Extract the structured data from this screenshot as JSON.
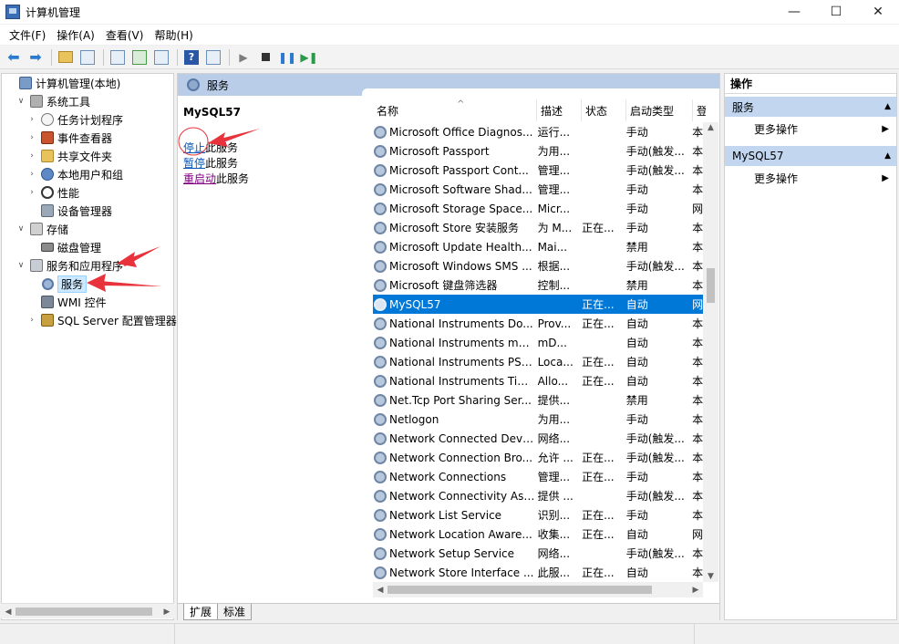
{
  "window": {
    "title": "计算机管理"
  },
  "menu": [
    "文件(F)",
    "操作(A)",
    "查看(V)",
    "帮助(H)"
  ],
  "tree": [
    {
      "label": "计算机管理(本地)",
      "arrow": "",
      "level": 0,
      "icon": "computer-icon"
    },
    {
      "label": "系统工具",
      "arrow": "∨",
      "level": 1,
      "icon": "tools-icon"
    },
    {
      "label": "任务计划程序",
      "arrow": "›",
      "level": 2,
      "icon": "clock-icon"
    },
    {
      "label": "事件查看器",
      "arrow": "›",
      "level": 2,
      "icon": "event-viewer-icon"
    },
    {
      "label": "共享文件夹",
      "arrow": "›",
      "level": 2,
      "icon": "shared-folder-icon"
    },
    {
      "label": "本地用户和组",
      "arrow": "›",
      "level": 2,
      "icon": "users-icon"
    },
    {
      "label": "性能",
      "arrow": "›",
      "level": 2,
      "icon": "performance-icon"
    },
    {
      "label": "设备管理器",
      "arrow": "",
      "level": 2,
      "icon": "device-manager-icon"
    },
    {
      "label": "存储",
      "arrow": "∨",
      "level": 1,
      "icon": "storage-icon"
    },
    {
      "label": "磁盘管理",
      "arrow": "",
      "level": 2,
      "icon": "disk-icon"
    },
    {
      "label": "服务和应用程序",
      "arrow": "∨",
      "level": 1,
      "icon": "apps-icon"
    },
    {
      "label": "服务",
      "arrow": "",
      "level": 2,
      "icon": "services-gear-icon",
      "selected": true
    },
    {
      "label": "WMI 控件",
      "arrow": "",
      "level": 2,
      "icon": "wmi-icon"
    },
    {
      "label": "SQL Server 配置管理器",
      "arrow": "›",
      "level": 2,
      "icon": "sql-server-icon"
    }
  ],
  "center": {
    "header": "服务",
    "detail": {
      "name": "MySQL57",
      "stop_link": "停止",
      "stop_rest": "此服务",
      "pause_link": "暂停",
      "pause_rest": "此服务",
      "restart_link": "重启动",
      "restart_rest": "此服务"
    },
    "columns": [
      "名称",
      "描述",
      "状态",
      "启动类型",
      "登"
    ],
    "rows": [
      {
        "name": "Microsoft Office Diagnos...",
        "desc": "运行...",
        "status": "",
        "startup": "手动",
        "logon": "本"
      },
      {
        "name": "Microsoft Passport",
        "desc": "为用...",
        "status": "",
        "startup": "手动(触发...",
        "logon": "本"
      },
      {
        "name": "Microsoft Passport Cont...",
        "desc": "管理...",
        "status": "",
        "startup": "手动(触发...",
        "logon": "本"
      },
      {
        "name": "Microsoft Software Shad...",
        "desc": "管理...",
        "status": "",
        "startup": "手动",
        "logon": "本"
      },
      {
        "name": "Microsoft Storage Space...",
        "desc": "Micr...",
        "status": "",
        "startup": "手动",
        "logon": "网"
      },
      {
        "name": "Microsoft Store 安装服务",
        "desc": "为 M...",
        "status": "正在...",
        "startup": "手动",
        "logon": "本"
      },
      {
        "name": "Microsoft Update Health...",
        "desc": "Mai...",
        "status": "",
        "startup": "禁用",
        "logon": "本"
      },
      {
        "name": "Microsoft Windows SMS ...",
        "desc": "根据...",
        "status": "",
        "startup": "手动(触发...",
        "logon": "本"
      },
      {
        "name": "Microsoft 键盘筛选器",
        "desc": "控制...",
        "status": "",
        "startup": "禁用",
        "logon": "本"
      },
      {
        "name": "MySQL57",
        "desc": "",
        "status": "正在...",
        "startup": "自动",
        "logon": "网",
        "selected": true
      },
      {
        "name": "National Instruments Do...",
        "desc": "Prov...",
        "status": "正在...",
        "startup": "自动",
        "logon": "本"
      },
      {
        "name": "National Instruments mD...",
        "desc": "mD...",
        "status": "",
        "startup": "自动",
        "logon": "本"
      },
      {
        "name": "National Instruments PSP...",
        "desc": "Loca...",
        "status": "正在...",
        "startup": "自动",
        "logon": "本"
      },
      {
        "name": "National Instruments Tim...",
        "desc": "Allo...",
        "status": "正在...",
        "startup": "自动",
        "logon": "本"
      },
      {
        "name": "Net.Tcp Port Sharing Ser...",
        "desc": "提供...",
        "status": "",
        "startup": "禁用",
        "logon": "本"
      },
      {
        "name": "Netlogon",
        "desc": "为用...",
        "status": "",
        "startup": "手动",
        "logon": "本"
      },
      {
        "name": "Network Connected Devi...",
        "desc": "网络...",
        "status": "",
        "startup": "手动(触发...",
        "logon": "本"
      },
      {
        "name": "Network Connection Bro...",
        "desc": "允许 ...",
        "status": "正在...",
        "startup": "手动(触发...",
        "logon": "本"
      },
      {
        "name": "Network Connections",
        "desc": "管理...",
        "status": "正在...",
        "startup": "手动",
        "logon": "本"
      },
      {
        "name": "Network Connectivity Ass...",
        "desc": "提供 ...",
        "status": "",
        "startup": "手动(触发...",
        "logon": "本"
      },
      {
        "name": "Network List Service",
        "desc": "识别...",
        "status": "正在...",
        "startup": "手动",
        "logon": "本"
      },
      {
        "name": "Network Location Aware...",
        "desc": "收集...",
        "status": "正在...",
        "startup": "自动",
        "logon": "网"
      },
      {
        "name": "Network Setup Service",
        "desc": "网络...",
        "status": "",
        "startup": "手动(触发...",
        "logon": "本"
      },
      {
        "name": "Network Store Interface ...",
        "desc": "此服...",
        "status": "正在...",
        "startup": "自动",
        "logon": "本"
      }
    ],
    "tabs": [
      "扩展",
      "标准"
    ]
  },
  "actions": {
    "title": "操作",
    "groups": [
      {
        "label": "服务",
        "item": "更多操作"
      },
      {
        "label": "MySQL57",
        "item": "更多操作"
      }
    ]
  },
  "colors": {
    "accent": "#0078d7",
    "header_blue": "#b9cde8",
    "group_blue": "#c2d6ef",
    "annotation_red": "#e8323c"
  }
}
